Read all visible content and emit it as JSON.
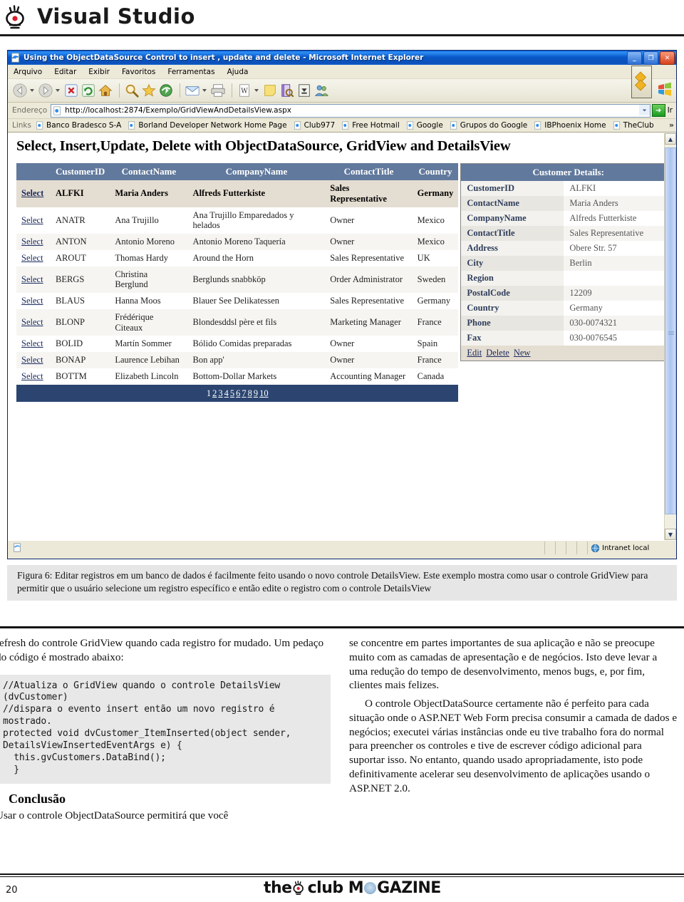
{
  "masthead": {
    "title": "Visual Studio",
    "logo_icon": "vs-bulb-icon"
  },
  "browser": {
    "title": "Using the ObjectDataSource Control to insert , update and delete - Microsoft Internet Explorer",
    "window_buttons": [
      {
        "name": "minimize",
        "glyph": "_"
      },
      {
        "name": "restore",
        "glyph": "❐"
      },
      {
        "name": "close",
        "glyph": "✕"
      }
    ],
    "menu": [
      "Arquivo",
      "Editar",
      "Exibir",
      "Favoritos",
      "Ferramentas",
      "Ajuda"
    ],
    "toolbar_icons": [
      "back-icon",
      "forward-icon",
      "stop-icon",
      "refresh-icon",
      "home-icon",
      "search-icon",
      "favorites-icon",
      "history-icon",
      "mail-icon",
      "print-icon",
      "edit-word-icon",
      "notes-icon",
      "research-icon",
      "messenger-icon",
      "people-icon"
    ],
    "address": {
      "label": "Endereço",
      "url": "http://localhost:2874/Exemplo/GridViewAndDetailsView.aspx",
      "go_label": "Ir"
    },
    "links": {
      "label": "Links",
      "items": [
        "Banco Bradesco S-A",
        "Borland Developer Network Home Page",
        "Club977",
        "Free Hotmail",
        "Google",
        "Grupos do Google",
        "IBPhoenix Home",
        "TheClub"
      ],
      "overflow": "»"
    },
    "status": {
      "zone": "Intranet local"
    }
  },
  "page": {
    "heading": "Select, Insert,Update, Delete with ObjectDataSource, GridView and DetailsView",
    "grid": {
      "select_label": "Select",
      "columns": [
        "",
        "CustomerID",
        "ContactName",
        "CompanyName",
        "ContactTitle",
        "Country"
      ],
      "rows": [
        {
          "id": "ALFKI",
          "contact": "Maria Anders",
          "company": "Alfreds Futterkiste",
          "title": "Sales Representative",
          "country": "Germany",
          "selected": true
        },
        {
          "id": "ANATR",
          "contact": "Ana Trujillo",
          "company": "Ana Trujillo Emparedados y helados",
          "title": "Owner",
          "country": "Mexico",
          "selected": false
        },
        {
          "id": "ANTON",
          "contact": "Antonio Moreno",
          "company": "Antonio Moreno Taquería",
          "title": "Owner",
          "country": "Mexico",
          "selected": false
        },
        {
          "id": "AROUT",
          "contact": "Thomas Hardy",
          "company": "Around the Horn",
          "title": "Sales Representative",
          "country": "UK",
          "selected": false
        },
        {
          "id": "BERGS",
          "contact": "Christina Berglund",
          "company": "Berglunds snabbköp",
          "title": "Order Administrator",
          "country": "Sweden",
          "selected": false
        },
        {
          "id": "BLAUS",
          "contact": "Hanna Moos",
          "company": "Blauer See Delikatessen",
          "title": "Sales Representative",
          "country": "Germany",
          "selected": false
        },
        {
          "id": "BLONP",
          "contact": "Frédérique Citeaux",
          "company": "Blondesddsl père et fils",
          "title": "Marketing Manager",
          "country": "France",
          "selected": false
        },
        {
          "id": "BOLID",
          "contact": "Martín Sommer",
          "company": "Bólido Comidas preparadas",
          "title": "Owner",
          "country": "Spain",
          "selected": false
        },
        {
          "id": "BONAP",
          "contact": "Laurence Lebihan",
          "company": "Bon app'",
          "title": "Owner",
          "country": "France",
          "selected": false
        },
        {
          "id": "BOTTM",
          "contact": "Elizabeth Lincoln",
          "company": "Bottom-Dollar Markets",
          "title": "Accounting Manager",
          "country": "Canada",
          "selected": false
        }
      ],
      "pager": [
        "1",
        "2",
        "3",
        "4",
        "5",
        "6",
        "7",
        "8",
        "9",
        "10"
      ],
      "pager_current": "1"
    },
    "details": {
      "header": "Customer Details:",
      "fields": [
        {
          "key": "CustomerID",
          "value": "ALFKI"
        },
        {
          "key": "ContactName",
          "value": "Maria Anders"
        },
        {
          "key": "CompanyName",
          "value": "Alfreds Futterkiste"
        },
        {
          "key": "ContactTitle",
          "value": "Sales Representative"
        },
        {
          "key": "Address",
          "value": "Obere Str. 57"
        },
        {
          "key": "City",
          "value": "Berlin"
        },
        {
          "key": "Region",
          "value": ""
        },
        {
          "key": "PostalCode",
          "value": "12209"
        },
        {
          "key": "Country",
          "value": "Germany"
        },
        {
          "key": "Phone",
          "value": "030-0074321"
        },
        {
          "key": "Fax",
          "value": "030-0076545"
        }
      ],
      "commands": [
        "Edit",
        "Delete",
        "New"
      ]
    }
  },
  "figure": {
    "caption": "Figura 6: Editar registros em um banco de dados é facilmente feito usando o novo controle DetailsView. Este exemplo mostra como usar o controle GridView para permitir que o usuário selecione um registro específico e então edite o registro com o controle DetailsView"
  },
  "article": {
    "left_intro": "refresh do controle GridView quando cada registro for mudado. Um pedaço do código é mostrado abaixo:",
    "code": "//Atualiza o GridView quando o controle DetailsView (dvCustomer)\n//dispara o evento insert então um novo registro é mostrado.\nprotected void dvCustomer_ItemInserted(object sender, DetailsViewInsertedEventArgs e) {\n  this.gvCustomers.DataBind();\n  }",
    "conclusion_heading": "Conclusão",
    "conclusion_p1": "Usar o controle ObjectDataSource permitirá que você",
    "right_p1": "se concentre em partes importantes de sua aplicação e não se preocupe muito com as camadas de apresentação e de negócios. Isto deve levar a uma redução do tempo de desenvolvimento, menos bugs, e, por fim, clientes mais felizes.",
    "right_p2": "O controle ObjectDataSource certamente não é perfeito para cada situação onde o ASP.NET Web Form precisa consumir a camada de dados e negócios; executei várias instâncias onde eu tive trabalho fora do normal para preencher os controles e tive de escrever código adicional para suportar isso. No entanto, quando usado apropriadamente, isto pode definitivamente acelerar seu desenvolvimento de aplicações usando o ASP.NET 2.0."
  },
  "footer": {
    "page_number": "20",
    "logo_pre": "the",
    "logo_mid": "club M",
    "logo_post": "GAZINE"
  },
  "colors": {
    "grid_header": "#61799c",
    "pager_bar": "#2b4570",
    "selected_row": "#e4ddd1",
    "title_bar": "#0a59c8"
  }
}
